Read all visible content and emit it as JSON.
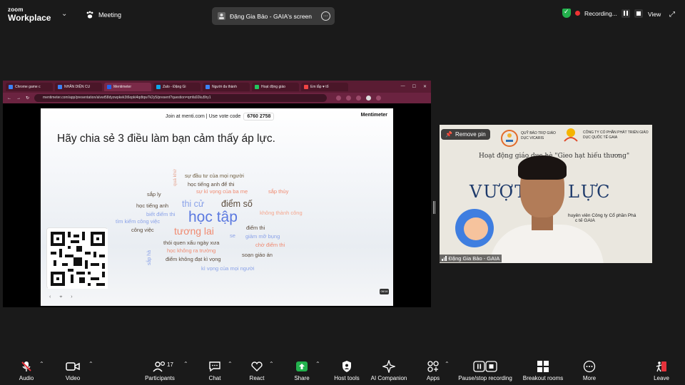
{
  "app": {
    "brand_line1": "zoom",
    "brand_line2": "Workplace",
    "meeting_label": "Meeting",
    "share_title": "Đặng Gia Bảo - GAIA's screen",
    "recording_label": "Recording...",
    "view_label": "View"
  },
  "browser": {
    "tabs": [
      "Chrome game c",
      "NHÂN DIỆN CU",
      "Mentimeter",
      "Zalo - Đặng Gi",
      "Người đa thành",
      "Hoạt động giáo",
      "Em lắp ♥ tổ"
    ],
    "active_tab_index": 2,
    "url": "mentimeter.com/app/presentation/alvwt58dyzwpkek3t6opki4qdtqw7k2y5/present?question=qmfa92ku5hy1"
  },
  "slide": {
    "join_text": "Join at menti.com | Use vote code",
    "vote_code": "6760 2758",
    "logo_text": "Mentimeter",
    "question": "Hãy chia sẻ 3 điều làm bạn cảm thấy áp lực.",
    "counter": "06/16",
    "words": [
      {
        "text": "sự đầu tư của mọi người",
        "color": "#6b5a3c"
      },
      {
        "text": "học tiếng anh để thi",
        "color": "#5a4a3a"
      },
      {
        "text": "quá khứ",
        "color": "#e5a28d"
      },
      {
        "text": "sự kì vọng của ba mẹ",
        "color": "#f08a70"
      },
      {
        "text": "sắp ly",
        "color": "#5a4a3a"
      },
      {
        "text": "sắp thủy",
        "color": "#f08a70"
      },
      {
        "text": "học tiếng anh",
        "color": "#5a4a3a"
      },
      {
        "text": "thi cử",
        "color": "#8aa2e8"
      },
      {
        "text": "điểm số",
        "color": "#5a4a3a"
      },
      {
        "text": "biết điểm thi",
        "color": "#8aa2e8"
      },
      {
        "text": "học tập",
        "color": "#5b79e0"
      },
      {
        "text": "không thành công",
        "color": "#f5a68e"
      },
      {
        "text": "tìm kiếm công việc",
        "color": "#8aa2e8"
      },
      {
        "text": "công việc",
        "color": "#5a4a3a"
      },
      {
        "text": "tương lai",
        "color": "#f08a70"
      },
      {
        "text": "điểm thi",
        "color": "#5a4a3a"
      },
      {
        "text": "se",
        "color": "#8aa2e8"
      },
      {
        "text": "giảm mỡ bụng",
        "color": "#8aa2e8"
      },
      {
        "text": "thói quen xấu ngày xưa",
        "color": "#5a4a3a"
      },
      {
        "text": "chờ điểm thi",
        "color": "#f08a70"
      },
      {
        "text": "sắp hà",
        "color": "#8aa2e8"
      },
      {
        "text": "học không ra trường",
        "color": "#f08a70"
      },
      {
        "text": "soạn giáo án",
        "color": "#5a4a3a"
      },
      {
        "text": "điểm không đạt kì vọng",
        "color": "#5a4a3a"
      },
      {
        "text": "kì vọng của mọi người",
        "color": "#8aa2e8"
      }
    ]
  },
  "video": {
    "remove_pin": "Remove pin",
    "org1_name": "QUỸ BẢO TRỢ GIÁO DỤC VICARIS",
    "org2_name": "CÔNG TY CỔ PHẦN PHÁT TRIỂN GIÁO DỤC QUỐC TẾ GAIA",
    "activity": "Hoạt động giáo dục hè \"Gieo hạt hiếu thương\"",
    "heading": "VƯỢT       ÁP LỰC",
    "caption1": "huyên viên Công ty Cổ phần Phá",
    "caption2": "c tế GAIA",
    "participant_name": "Đặng Gia Bảo - GAIA"
  },
  "toolbar": {
    "audio": "Audio",
    "video": "Video",
    "participants": "Participants",
    "participants_count": "17",
    "chat": "Chat",
    "react": "React",
    "share": "Share",
    "host_tools": "Host tools",
    "ai_companion": "AI Companion",
    "apps": "Apps",
    "pause_stop": "Pause/stop recording",
    "breakout": "Breakout rooms",
    "more": "More",
    "leave": "Leave"
  },
  "colors": {
    "accent_green": "#23b14d",
    "leave_red": "#e5323b",
    "browser_frame": "#6b2340"
  }
}
